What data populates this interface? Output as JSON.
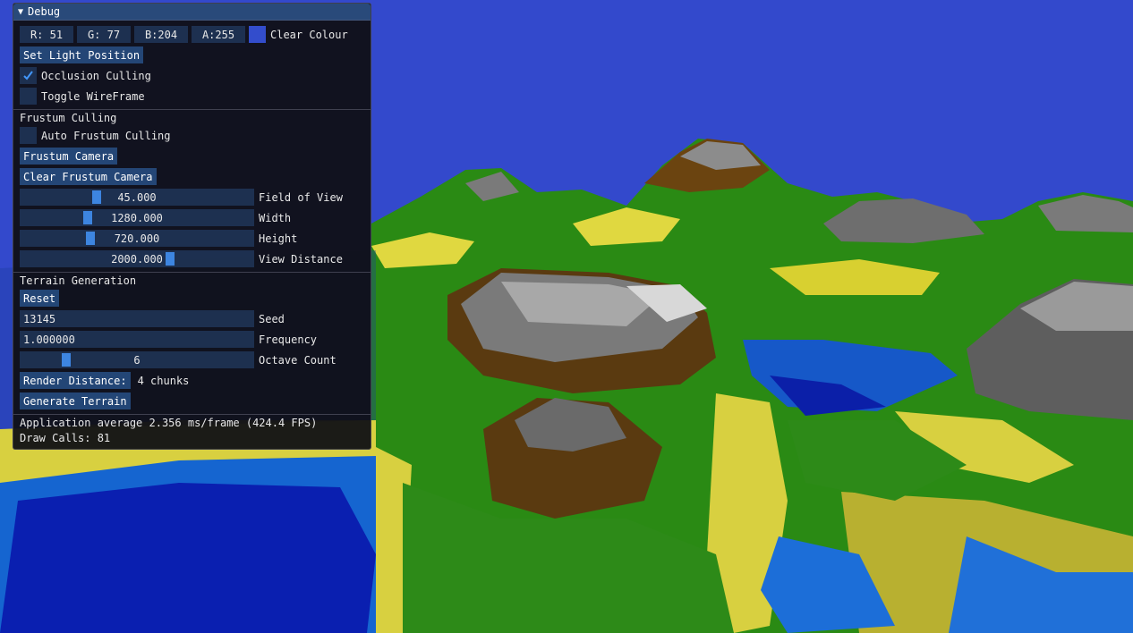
{
  "window": {
    "title": "Debug"
  },
  "clear_colour": {
    "r": "R: 51",
    "g": "G: 77",
    "b": "B:204",
    "a": "A:255",
    "label": "Clear Colour",
    "swatch": "#334dcc"
  },
  "buttons": {
    "set_light": "Set Light Position",
    "frustum_camera": "Frustum Camera",
    "clear_frustum_camera": "Clear Frustum Camera",
    "reset": "Reset",
    "render_distance": "Render Distance:",
    "generate_terrain": "Generate Terrain"
  },
  "checkboxes": {
    "occlusion_culling": {
      "label": "Occlusion Culling",
      "checked": true
    },
    "toggle_wireframe": {
      "label": "Toggle WireFrame",
      "checked": false
    },
    "auto_frustum_culling": {
      "label": "Auto Frustum Culling",
      "checked": false
    }
  },
  "sections": {
    "frustum": "Frustum Culling",
    "terrain": "Terrain Generation"
  },
  "sliders": {
    "fov": {
      "value": "45.000",
      "label": "Field of View",
      "fraction": 0.32
    },
    "width": {
      "value": "1280.000",
      "label": "Width",
      "fraction": 0.28
    },
    "height": {
      "value": "720.000",
      "label": "Height",
      "fraction": 0.29
    },
    "view_distance": {
      "value": "2000.000",
      "label": "View Distance",
      "fraction": 0.65
    },
    "octave": {
      "value": "6",
      "label": "Octave Count",
      "fraction": 0.18
    }
  },
  "inputs": {
    "seed": {
      "value": "13145",
      "label": "Seed"
    },
    "frequency": {
      "value": "1.000000",
      "label": "Frequency"
    }
  },
  "render_distance_value": "4 chunks",
  "stats": {
    "fps": "Application average 2.356 ms/frame (424.4 FPS)",
    "draw_calls": "Draw Calls: 81"
  },
  "colors": {
    "sky": "#3349cc",
    "accent": "#4296fa",
    "title_bg": "#294a7a"
  }
}
